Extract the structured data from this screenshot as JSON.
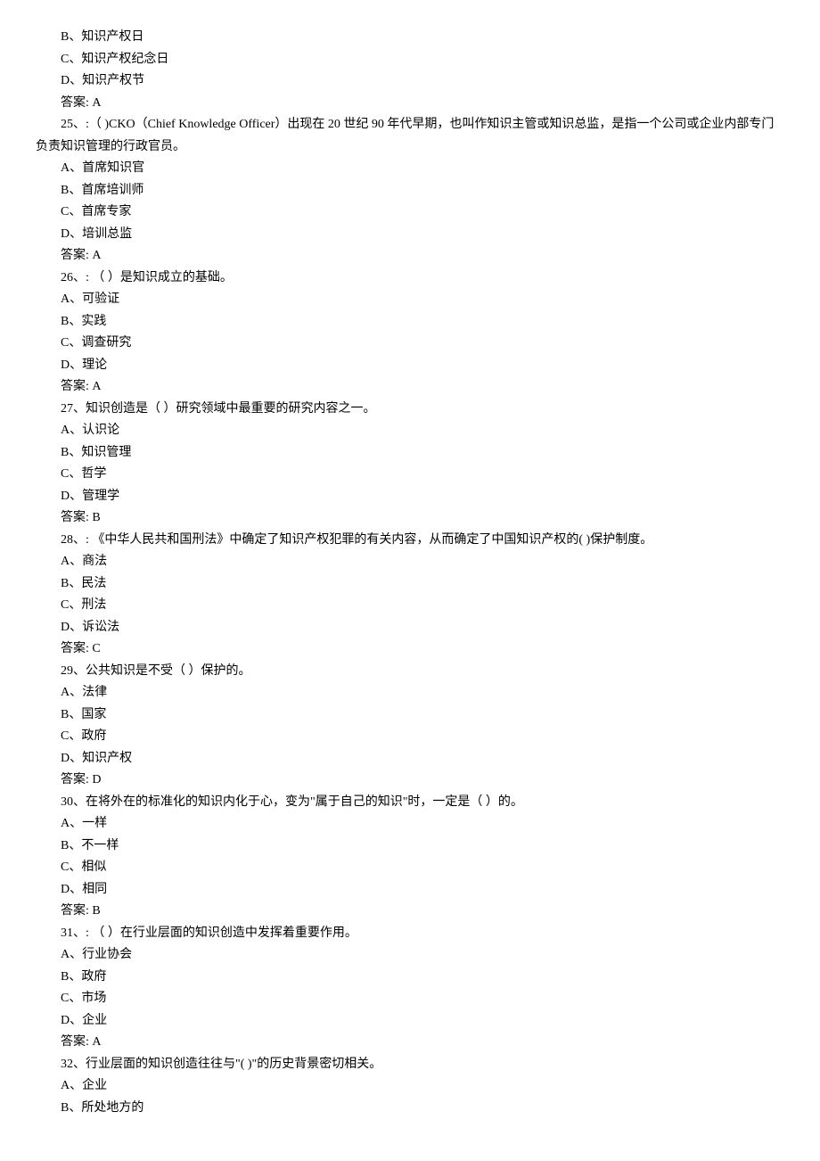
{
  "lines": [
    {
      "text": "B、知识产权日",
      "indent": "line"
    },
    {
      "text": "C、知识产权纪念日",
      "indent": "line"
    },
    {
      "text": "D、知识产权节",
      "indent": "line"
    },
    {
      "text": "答案:   A",
      "indent": "line"
    },
    {
      "text": " 25、:（ )CKO（Chief Knowledge Officer）出现在 20 世纪 90 年代早期，也叫作知识主管或知识总监，是指一个公司或企业内部专门",
      "indent": "line"
    },
    {
      "text": "负责知识管理的行政官员。",
      "indent": "line-noindent"
    },
    {
      "text": "A、首席知识官",
      "indent": "line"
    },
    {
      "text": "B、首席培训师",
      "indent": "line"
    },
    {
      "text": "C、首席专家",
      "indent": "line"
    },
    {
      "text": "D、培训总监",
      "indent": "line"
    },
    {
      "text": "答案:   A",
      "indent": "line"
    },
    {
      "text": " 26、: （  ）是知识成立的基础。",
      "indent": "line"
    },
    {
      "text": "A、可验证",
      "indent": "line"
    },
    {
      "text": "B、实践",
      "indent": "line"
    },
    {
      "text": "C、调查研究",
      "indent": "line"
    },
    {
      "text": "D、理论",
      "indent": "line"
    },
    {
      "text": "答案:   A",
      "indent": "line"
    },
    {
      "text": " 27、知识创造是（  ）研究领域中最重要的研究内容之一。",
      "indent": "line"
    },
    {
      "text": "A、认识论",
      "indent": "line"
    },
    {
      "text": "B、知识管理",
      "indent": "line"
    },
    {
      "text": "C、哲学",
      "indent": "line"
    },
    {
      "text": "D、管理学",
      "indent": "line"
    },
    {
      "text": "答案:   B",
      "indent": "line"
    },
    {
      "text": " 28、: 《中华人民共和国刑法》中确定了知识产权犯罪的有关内容，从而确定了中国知识产权的( )保护制度。",
      "indent": "line"
    },
    {
      "text": "A、商法",
      "indent": "line"
    },
    {
      "text": "B、民法",
      "indent": "line"
    },
    {
      "text": "C、刑法",
      "indent": "line"
    },
    {
      "text": "D、诉讼法",
      "indent": "line"
    },
    {
      "text": "答案:   C",
      "indent": "line"
    },
    {
      "text": " 29、公共知识是不受（  ）保护的。",
      "indent": "line"
    },
    {
      "text": "A、法律",
      "indent": "line"
    },
    {
      "text": "B、国家",
      "indent": "line"
    },
    {
      "text": "C、政府",
      "indent": "line"
    },
    {
      "text": "D、知识产权",
      "indent": "line"
    },
    {
      "text": "答案:   D",
      "indent": "line"
    },
    {
      "text": " 30、在将外在的标准化的知识内化于心，变为\"属于自己的知识\"时，一定是（  ）的。",
      "indent": "line"
    },
    {
      "text": "A、一样",
      "indent": "line"
    },
    {
      "text": "B、不一样",
      "indent": "line"
    },
    {
      "text": "C、相似",
      "indent": "line"
    },
    {
      "text": "D、相同",
      "indent": "line"
    },
    {
      "text": "答案:   B",
      "indent": "line"
    },
    {
      "text": " 31、: （  ）在行业层面的知识创造中发挥着重要作用。",
      "indent": "line"
    },
    {
      "text": "A、行业协会",
      "indent": "line"
    },
    {
      "text": "B、政府",
      "indent": "line"
    },
    {
      "text": "C、市场",
      "indent": "line"
    },
    {
      "text": "D、企业",
      "indent": "line"
    },
    {
      "text": "答案:   A",
      "indent": "line"
    },
    {
      "text": " 32、行业层面的知识创造往往与\"( )\"的历史背景密切相关。",
      "indent": "line"
    },
    {
      "text": "A、企业",
      "indent": "line"
    },
    {
      "text": "B、所处地方的",
      "indent": "line"
    }
  ]
}
